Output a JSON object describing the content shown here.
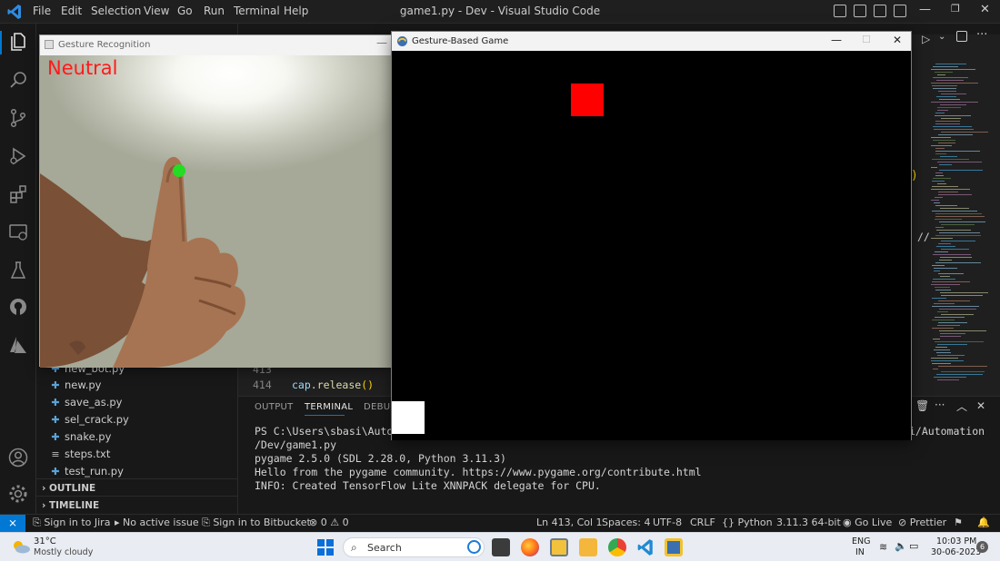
{
  "menu": [
    "File",
    "Edit",
    "Selection",
    "View",
    "Go",
    "Run",
    "Terminal",
    "Help"
  ],
  "window_title": "game1.py - Dev - Visual Studio Code",
  "sidebar": {
    "files": [
      {
        "name": "new_bot.py",
        "icon": "python-icon"
      },
      {
        "name": "new.py",
        "icon": "python-icon"
      },
      {
        "name": "save_as.py",
        "icon": "python-icon"
      },
      {
        "name": "sel_crack.py",
        "icon": "python-icon"
      },
      {
        "name": "snake.py",
        "icon": "python-icon"
      },
      {
        "name": "steps.txt",
        "icon": "text-file-icon"
      },
      {
        "name": "test_run.py",
        "icon": "python-icon"
      }
    ],
    "outline": "OUTLINE",
    "timeline": "TIMELINE"
  },
  "editor": {
    "lines": [
      {
        "num": "413",
        "code": ""
      },
      {
        "num": "414",
        "code": "cap.release()"
      }
    ],
    "partial_paren": ")",
    "partial_comment": "//"
  },
  "panel": {
    "tabs": [
      "OUTPUT",
      "TERMINAL",
      "DEBUG"
    ],
    "active_tab": "TERMINAL",
    "path_tail": "i/Automation",
    "terminal_lines": [
      "PS C:\\Users\\sbasi\\Automa",
      "/Dev/game1.py",
      "pygame 2.5.0 (SDL 2.28.0, Python 3.11.3)",
      "Hello from the pygame community. https://www.pygame.org/contribute.html",
      "INFO: Created TensorFlow Lite XNNPACK delegate for CPU."
    ]
  },
  "statusbar": {
    "left": [
      "Sign in to Jira",
      "No active issue",
      "Sign in to Bitbucket"
    ],
    "errors": "0",
    "warnings": "0",
    "right": [
      "Ln 413, Col 1",
      "Spaces: 4",
      "UTF-8",
      "CRLF",
      "Python",
      "3.11.3 64-bit",
      "Go Live",
      "Prettier"
    ]
  },
  "gesture_window": {
    "title": "Gesture Recognition",
    "gesture_label": "Neutral"
  },
  "game_window": {
    "title": "Gesture-Based Game"
  },
  "taskbar": {
    "weather_temp": "31°C",
    "weather_desc": "Mostly cloudy",
    "search_label": "Search",
    "lang": "ENG",
    "region": "IN",
    "time": "10:03 PM",
    "date": "30-06-2023",
    "notification_count": "6"
  },
  "colors": {
    "accent": "#0078d4",
    "enemy_block": "#ff0000",
    "player_block": "#ffffff",
    "gesture_text": "#ff1a1a",
    "fingertip_marker": "#22dd22"
  }
}
